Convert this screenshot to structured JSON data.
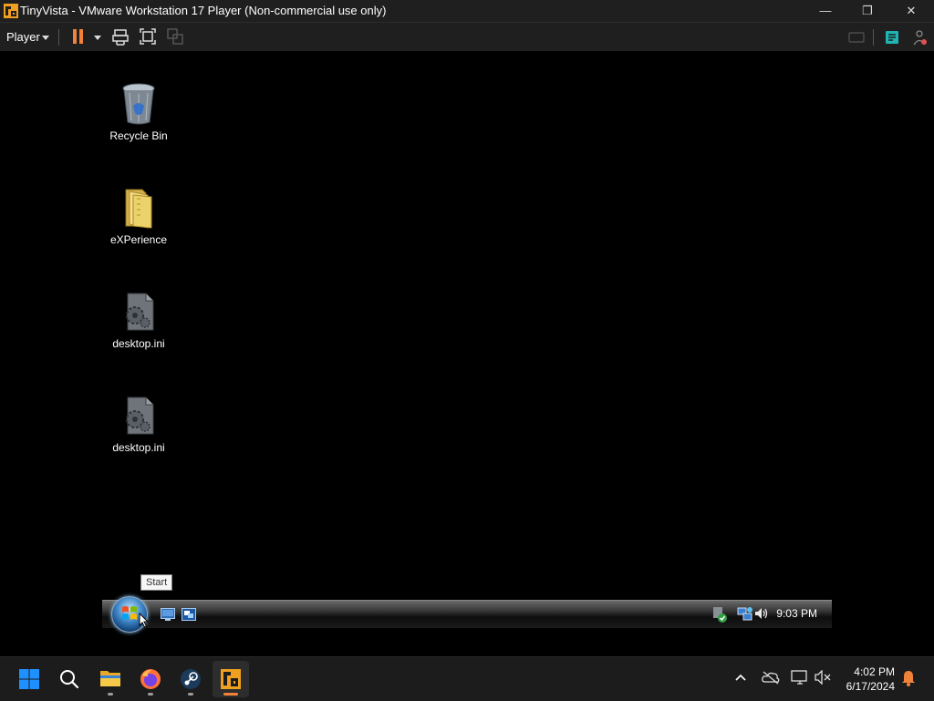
{
  "window": {
    "title": "TinyVista - VMware Workstation 17 Player (Non-commercial use only)",
    "minimize_glyph": "—",
    "restore_glyph": "❐",
    "close_glyph": "✕"
  },
  "toolbar": {
    "player_label": "Player"
  },
  "desktop": {
    "icons": [
      {
        "label": "Recycle Bin",
        "icon": "recycle-bin-icon"
      },
      {
        "label": "eXPerience",
        "icon": "folder-icon"
      },
      {
        "label": "desktop.ini",
        "icon": "config-file-icon"
      },
      {
        "label": "desktop.ini",
        "icon": "config-file-icon"
      }
    ]
  },
  "guest_taskbar": {
    "tooltip": "Start",
    "clock": "9:03 PM"
  },
  "host_taskbar": {
    "apps": [
      "start-icon",
      "search-icon",
      "file-explorer-icon",
      "firefox-icon",
      "steam-icon",
      "vmware-icon"
    ],
    "time": "4:02 PM",
    "date": "6/17/2024"
  },
  "colors": {
    "vmware_orange": "#f0823a",
    "win_blue": "#1e90ff"
  }
}
